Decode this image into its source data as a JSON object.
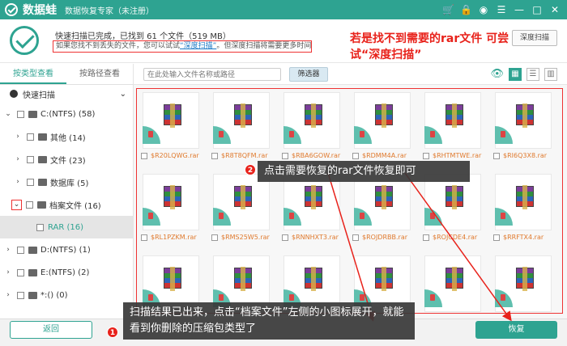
{
  "titlebar": {
    "brand": "数据蛙",
    "subtitle": "数据恢复专家（未注册）",
    "icons": [
      "cart-icon",
      "lock-icon",
      "user-icon",
      "menu-icon",
      "minimize-icon",
      "maximize-icon",
      "close-icon"
    ]
  },
  "info": {
    "status": "快速扫描已完成，已找到 61 个文件（519 MB）",
    "tip_before": "如果您找不到丢失的文件，您可以试试",
    "tip_link": "“深度扫描”",
    "tip_after": "。但深度扫描将需要更多时间。",
    "annotation_top": "若是找不到需要的rar文件 可尝试“深度扫描”",
    "deep_button": "深度扫描"
  },
  "sidebar": {
    "tabs": [
      {
        "label": "按类型查看",
        "active": true
      },
      {
        "label": "按路径查看",
        "active": false
      }
    ],
    "quick_scan": "快速扫描",
    "tree": [
      {
        "label": "C:(NTFS) (58)",
        "level": 0,
        "arrow": "⌄"
      },
      {
        "label": "其他 (14)",
        "level": 1,
        "arrow": "›"
      },
      {
        "label": "文件 (23)",
        "level": 1,
        "arrow": "›"
      },
      {
        "label": "数据库 (5)",
        "level": 1,
        "arrow": "›"
      },
      {
        "label": "档案文件 (16)",
        "level": 1,
        "arrow": "⌄"
      },
      {
        "label": "RAR (16)",
        "level": 2,
        "arrow": ""
      },
      {
        "label": "D:(NTFS) (1)",
        "level": 0,
        "arrow": "›"
      },
      {
        "label": "E:(NTFS) (2)",
        "level": 0,
        "arrow": "›"
      },
      {
        "label": "*:() (0)",
        "level": 0,
        "arrow": "›"
      }
    ]
  },
  "toolbar": {
    "search_placeholder": "在此处输入文件名称或路径",
    "filter_label": "筛选器"
  },
  "files": [
    "$R20LQWG.rar",
    "$R8T8QFM.rar",
    "$RBA6GOW.rar",
    "$RDMM4A.rar",
    "$RHTMTWE.rar",
    "$RI6Q3X8.rar",
    "$RL1PZKM.rar",
    "$RMS25W5.rar",
    "$RNNHXT3.rar",
    "$ROJDRBB.rar",
    "$ROJCDE4.rar",
    "$RRFTX4.rar",
    "",
    "",
    "",
    "",
    "",
    ""
  ],
  "footer": {
    "back": "返回",
    "recover": "恢复"
  },
  "callouts": {
    "one_num": "1",
    "one_text": "扫描结果已出来，点击“档案文件”左侧的小图标展开，就能看到你删除的压缩包类型了",
    "two_num": "2",
    "two_text": "点击需要恢复的rar文件恢复即可"
  },
  "colors": {
    "accent": "#2ea391",
    "annotation": "#e8221b"
  }
}
